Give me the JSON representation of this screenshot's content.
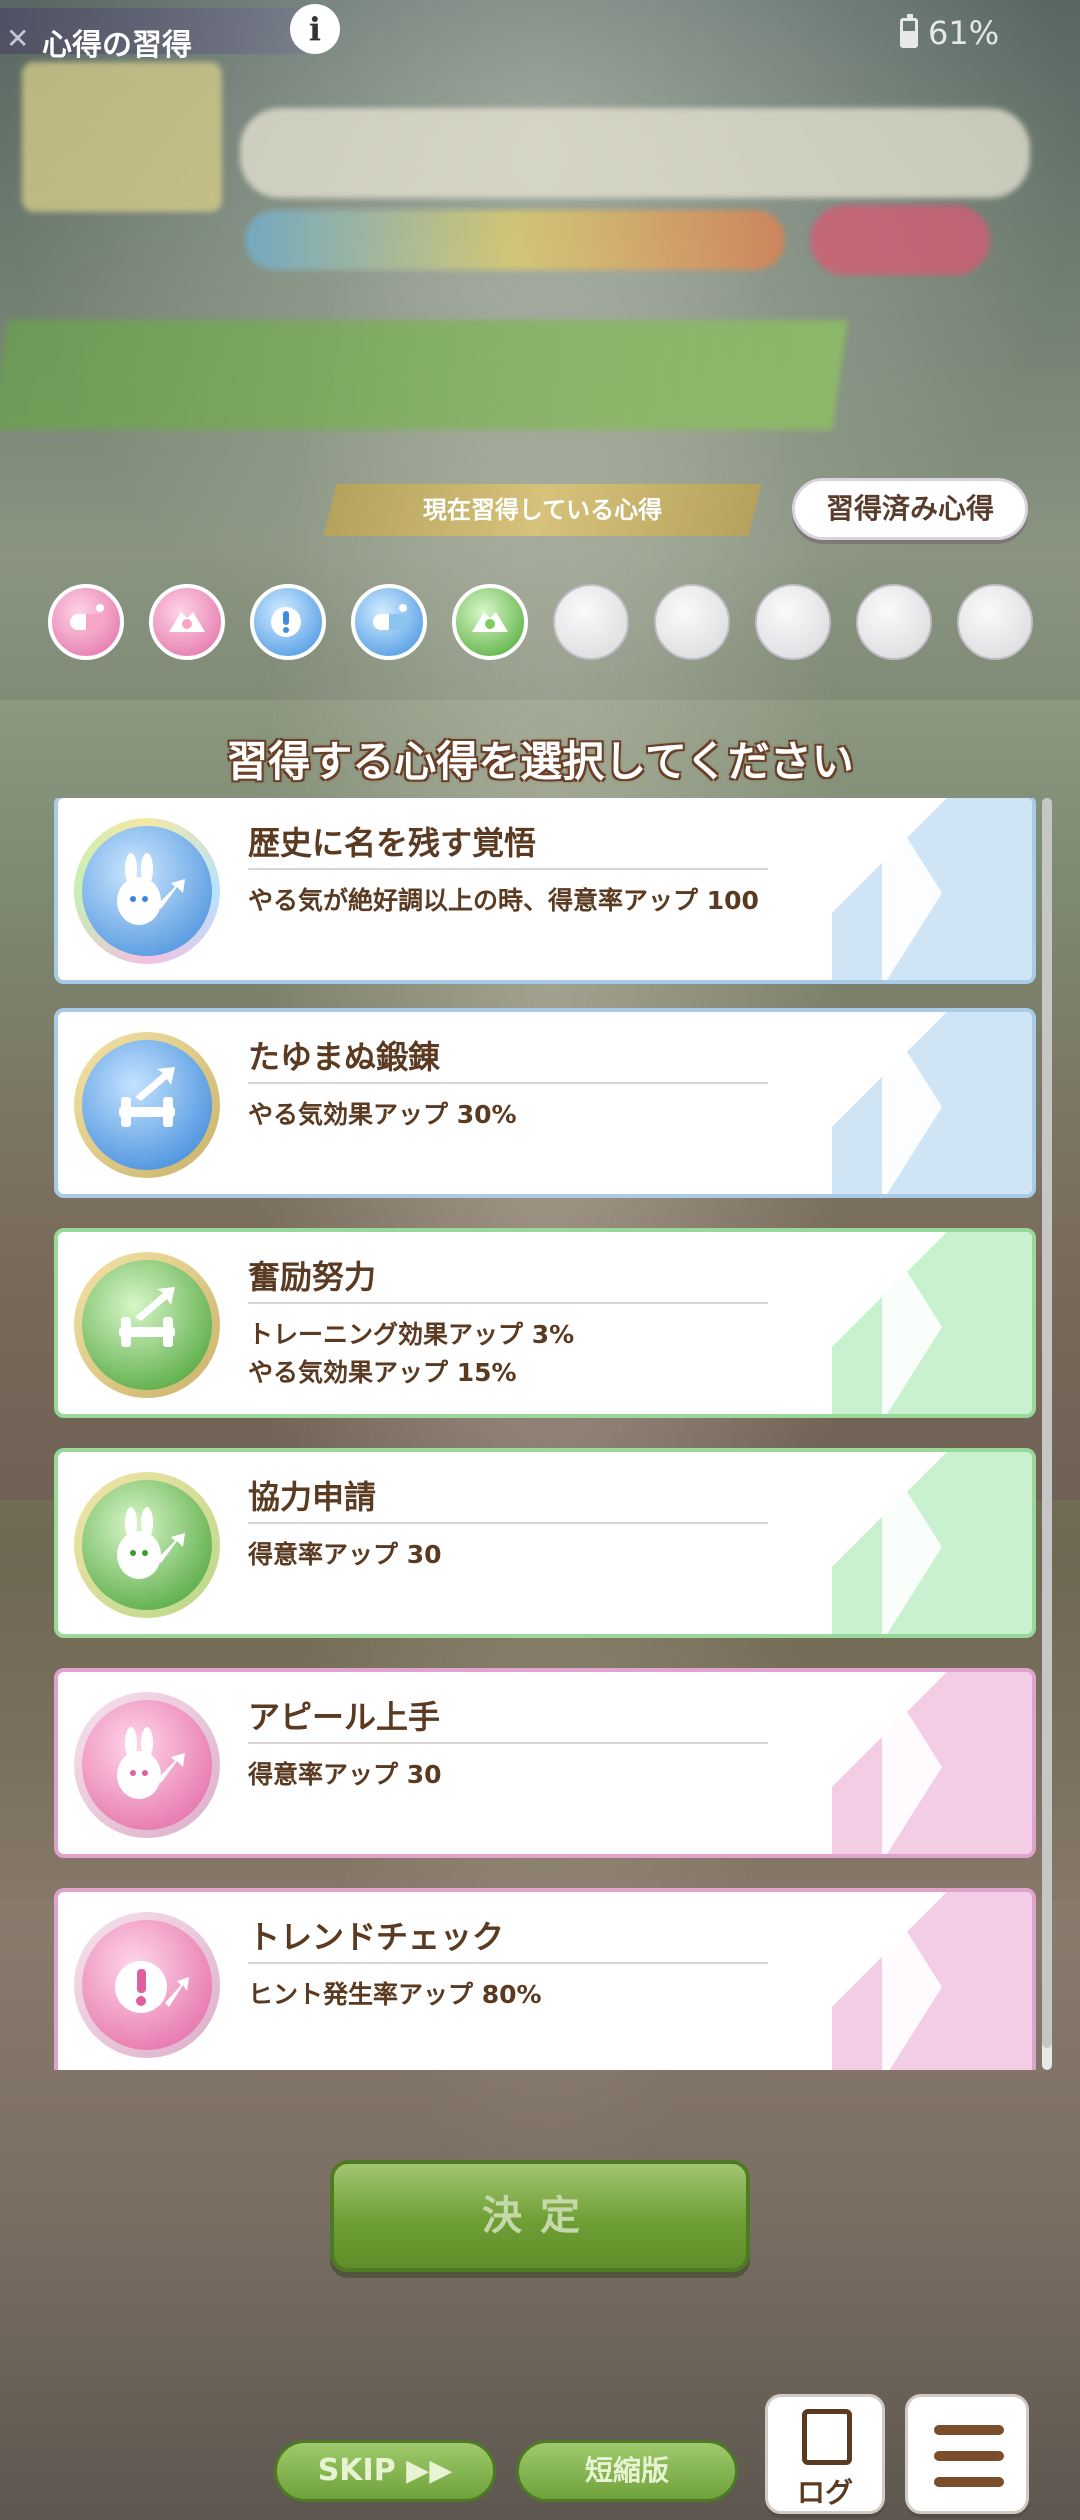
{
  "header": {
    "title": "心得の習得",
    "info": "i",
    "battery": "61%"
  },
  "learned": {
    "current_label": "現在習得している心得",
    "learned_button": "習得済み心得",
    "slots": [
      {
        "state": "filled",
        "color": "pink",
        "icon": "pill-icon"
      },
      {
        "state": "filled",
        "color": "pink",
        "icon": "handshake-icon"
      },
      {
        "state": "filled",
        "color": "blue",
        "icon": "exclamation-icon"
      },
      {
        "state": "filled",
        "color": "blue",
        "icon": "pill-icon"
      },
      {
        "state": "filled",
        "color": "green",
        "icon": "handshake-icon"
      },
      {
        "state": "empty"
      },
      {
        "state": "empty"
      },
      {
        "state": "empty"
      },
      {
        "state": "empty"
      },
      {
        "state": "empty"
      }
    ]
  },
  "prompt": "習得する心得を選択してください",
  "skills": [
    {
      "title": "歴史に名を残す覚悟",
      "desc": "やる気が絶好調以上の時、得意率アップ 100",
      "theme": "blue",
      "icon": "rabbit-up-icon"
    },
    {
      "title": "たゆまぬ鍛錬",
      "desc": "やる気効果アップ 30%",
      "theme": "blue",
      "icon": "dumbbell-icon"
    },
    {
      "title": "奮励努力",
      "desc": "トレーニング効果アップ 3%\nやる気効果アップ 15%",
      "theme": "green",
      "icon": "dumbbell-icon"
    },
    {
      "title": "協力申請",
      "desc": "得意率アップ 30",
      "theme": "green",
      "icon": "rabbit-up-icon"
    },
    {
      "title": "アピール上手",
      "desc": "得意率アップ 30",
      "theme": "pink",
      "icon": "rabbit-up-icon"
    },
    {
      "title": "トレンドチェック",
      "desc": "ヒント発生率アップ 80%",
      "theme": "pink",
      "icon": "exclamation-icon"
    }
  ],
  "buttons": {
    "confirm": "決定",
    "skip": "SKIP ▶▶",
    "short": "短縮版",
    "log": "ログ"
  },
  "colors": {
    "text_brown": "#5b3a22",
    "blue_theme": "#a9cbe6",
    "green_theme": "#98d89a",
    "pink_theme": "#e0a3cb",
    "confirm_green": "#6e9e34"
  }
}
